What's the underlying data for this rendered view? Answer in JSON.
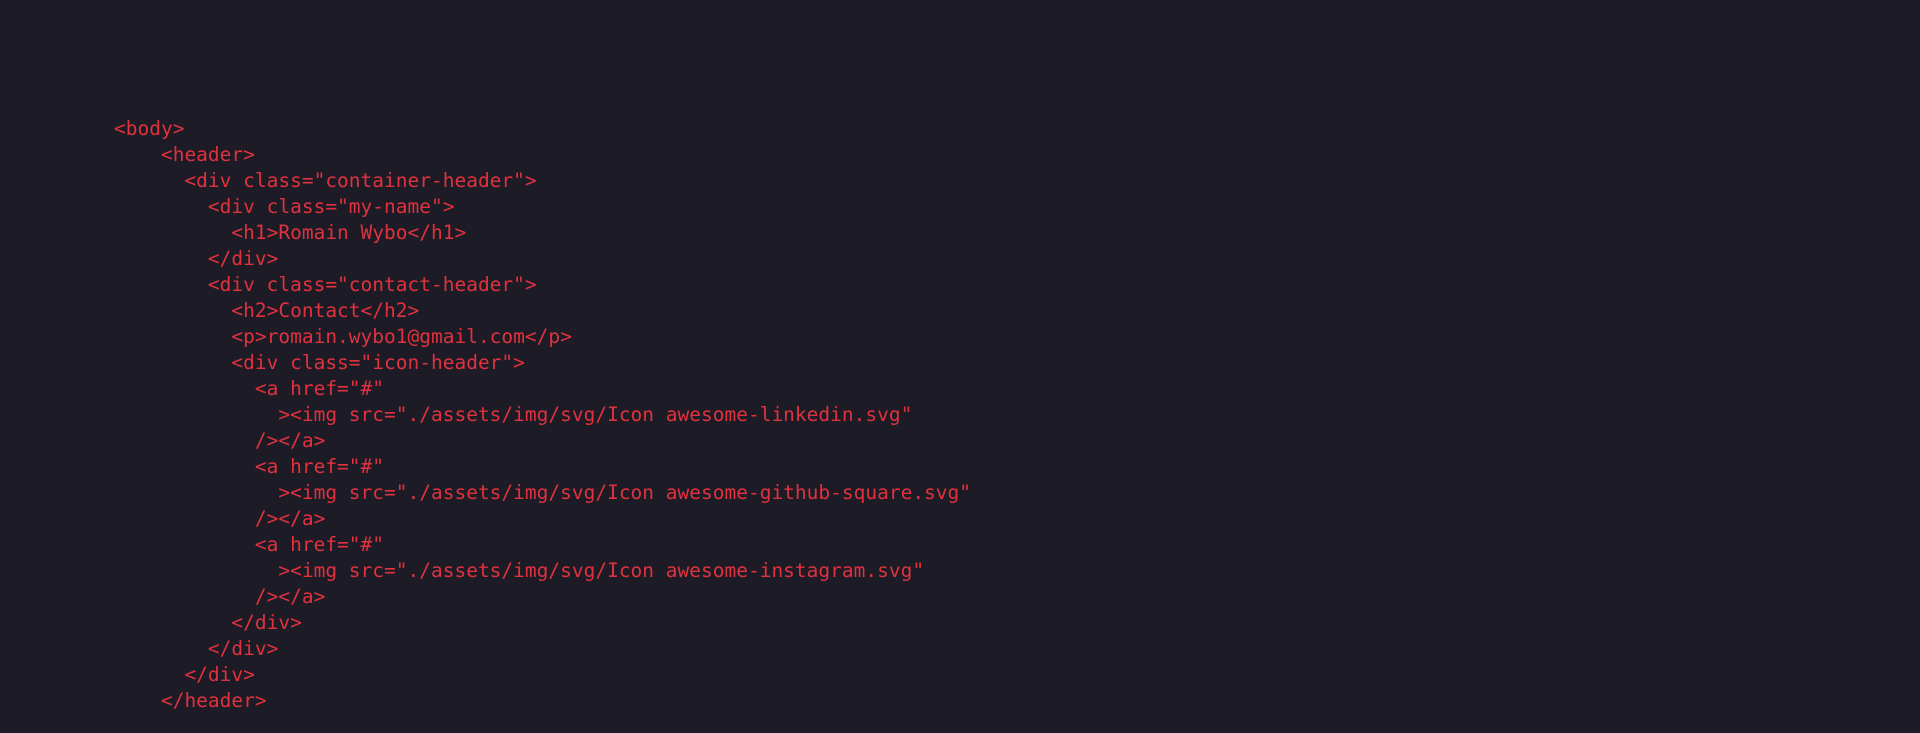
{
  "editor": {
    "text_color": "#e0323e",
    "background_color": "#1c1b26",
    "lines": [
      "<body>",
      "    <header>",
      "      <div class=\"container-header\">",
      "        <div class=\"my-name\">",
      "          <h1>Romain Wybo</h1>",
      "        </div>",
      "        <div class=\"contact-header\">",
      "          <h2>Contact</h2>",
      "          <p>romain.wybo1@gmail.com</p>",
      "          <div class=\"icon-header\">",
      "            <a href=\"#\"",
      "              ><img src=\"./assets/img/svg/Icon awesome-linkedin.svg\"",
      "            /></a>",
      "            <a href=\"#\"",
      "              ><img src=\"./assets/img/svg/Icon awesome-github-square.svg\"",
      "            /></a>",
      "            <a href=\"#\"",
      "              ><img src=\"./assets/img/svg/Icon awesome-instagram.svg\"",
      "            /></a>",
      "          </div>",
      "        </div>",
      "      </div>",
      "    </header>"
    ]
  }
}
